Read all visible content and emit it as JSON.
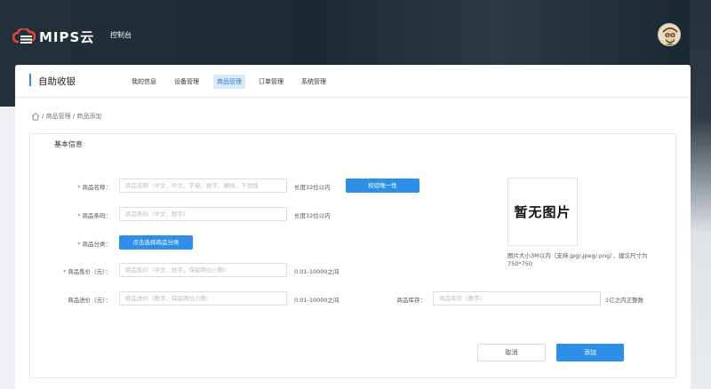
{
  "topbar": {
    "logo_text": "MIPS云",
    "console_label": "控制台"
  },
  "header": {
    "title": "自助收银",
    "tabs": [
      {
        "label": "我的信息"
      },
      {
        "label": "设备管理"
      },
      {
        "label": "商品管理",
        "active": true
      },
      {
        "label": "订单管理"
      },
      {
        "label": "系统管理"
      }
    ]
  },
  "breadcrumb": {
    "text": "/ 商品管理 / 商品添加"
  },
  "form": {
    "section_title": "基本信息",
    "name": {
      "label": "商品名称：",
      "placeholder": "商品名称（中文、中文、字母、数字、横线、下划线",
      "hint": "长度32位以内",
      "check_button": "校验唯一性"
    },
    "barcode": {
      "label": "商品条码：",
      "placeholder": "商品条码（中文、数字）",
      "hint": "长度32位以内"
    },
    "category": {
      "label": "商品分类：",
      "button": "点击选择商品分类"
    },
    "sale_price": {
      "label": "商品售价（元）：",
      "placeholder": "商品售价（中文、数字，保留两位小数）",
      "hint": "0.01-10000之间"
    },
    "cost_price": {
      "label": "商品进价（元）：",
      "placeholder": "商品进价（数字，保留两位小数）",
      "hint": "0.01-10000之间"
    },
    "stock": {
      "label": "商品库存：",
      "placeholder": "商品库存（数字）",
      "hint": "1亿之内正整数"
    },
    "image": {
      "placeholder_text": "暂无图片",
      "hint": "图片大小3M以内（支持.jpg/.jpeg/.png），建议尺寸为750*750"
    },
    "cancel_button": "取消",
    "add_button": "添加"
  },
  "colors": {
    "accent": "#2e8fe6",
    "required": "#e04545"
  }
}
